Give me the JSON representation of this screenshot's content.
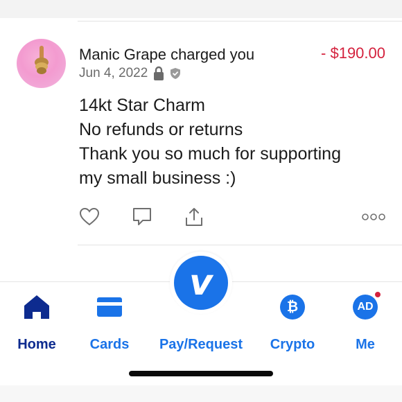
{
  "transaction": {
    "payer_name": "Manic Grape",
    "action_text": " charged you",
    "amount": "- $190.00",
    "date": "Jun 4, 2022",
    "privacy_icon": "lock-icon",
    "verified_icon": "shield-check-icon",
    "note_lines": [
      "14kt Star Charm",
      "No refunds or returns",
      "Thank you so much for supporting",
      "my small business :)"
    ],
    "actions": [
      "heart-icon",
      "comment-icon",
      "share-icon",
      "more-icon"
    ]
  },
  "fab": {
    "glyph": "v"
  },
  "tabs": {
    "home": "Home",
    "cards": "Cards",
    "pay_request": "Pay/Request",
    "crypto": "Crypto",
    "crypto_glyph": "₿",
    "me": "Me",
    "me_initials": "AD"
  },
  "colors": {
    "amount": "#d4213d",
    "accent": "#1a73e8",
    "home_active": "#0d2b8f",
    "notification_dot": "#d4213d"
  }
}
